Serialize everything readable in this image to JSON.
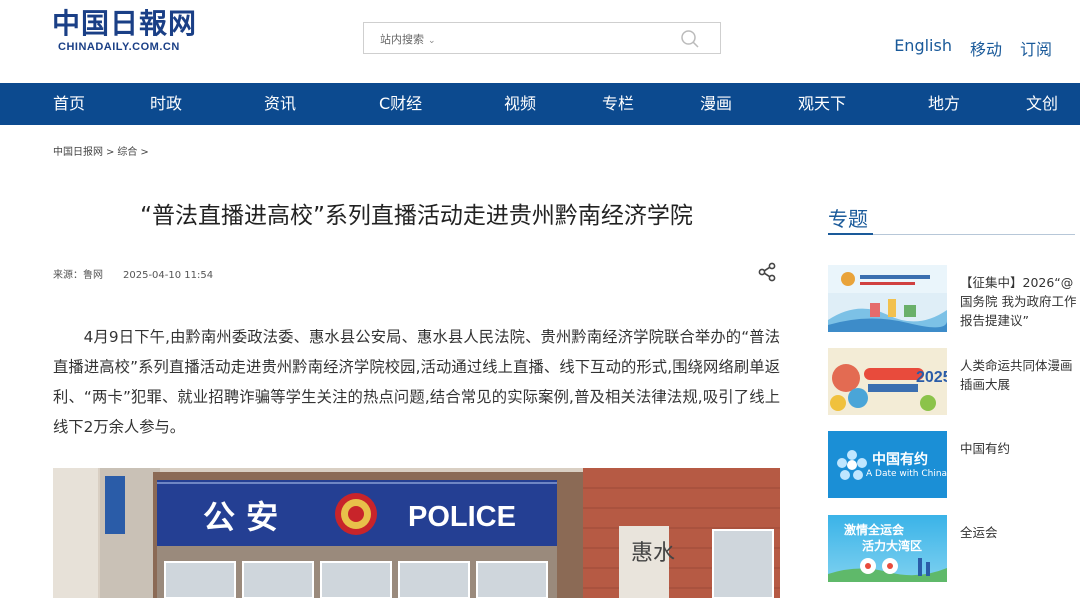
{
  "header": {
    "logo_cn": "中国日報网",
    "logo_en": "CHINADAILY.COM.CN",
    "search_scope": "站内搜索",
    "search_placeholder": "",
    "links": [
      "English",
      "移动",
      "订阅"
    ]
  },
  "nav": [
    "首页",
    "时政",
    "资讯",
    "C财经",
    "视频",
    "专栏",
    "漫画",
    "观天下",
    "地方",
    "文创"
  ],
  "breadcrumb": [
    "中国日报网",
    "综合"
  ],
  "article": {
    "title": "“普法直播进高校”系列直播活动走进贵州黔南经济学院",
    "source": "来源：鲁网",
    "date": "2025-04-10 11:54",
    "paragraph": "4月9日下午,由黔南州委政法委、惠水县公安局、惠水县人民法院、贵州黔南经济学院联合举办的“普法直播进高校”系列直播活动走进贵州黔南经济学院校园,活动通过线上直播、线下互动的形式,围绕网络刷单返利、“两卡”犯罪、就业招聘诈骗等学生关注的热点问题,结合常见的实际案例,普及相关法律法规,吸引了线上线下2万余人参与。",
    "photo": {
      "sign_cn": "公  安",
      "sign_en": "POLICE",
      "plaque": "惠水"
    }
  },
  "sidebar": {
    "title": "专题",
    "topics": [
      {
        "label": "【征集中】2026“@国务院 我为政府工作报告提建议”",
        "thumb_text": ""
      },
      {
        "label": "人类命运共同体漫画插画大展",
        "thumb_text": "2025"
      },
      {
        "label": "中国有约",
        "thumb_text": "中国有约",
        "thumb_sub": "A Date with China"
      },
      {
        "label": "全运会",
        "thumb_text": "激情全运会",
        "thumb_sub": "活力大湾区"
      }
    ]
  },
  "colors": {
    "nav_bg": "#0c4a8f",
    "brand": "#1a3f86",
    "link": "#1a5a9a"
  }
}
